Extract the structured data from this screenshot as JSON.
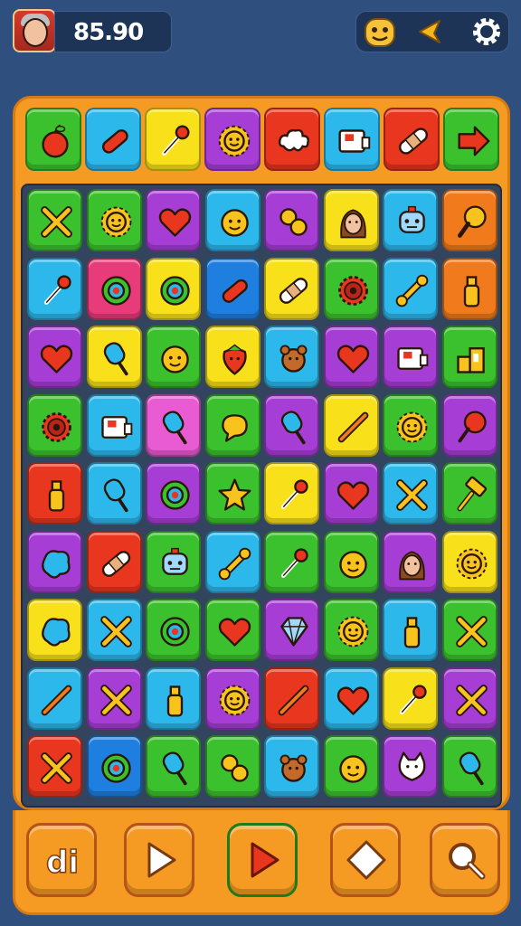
{
  "score": "85.90",
  "header": {
    "avatar_icon": "player-avatar",
    "emoji_icon": "smiley-face-icon",
    "arrow_icon": "back-triangle-icon",
    "settings_icon": "gear-icon"
  },
  "colors": {
    "board": "#f59a22",
    "background": "#2f4f7e",
    "grid_bg": "#33445e"
  },
  "top_row": [
    {
      "color": "#3cc12e",
      "icon": "apple"
    },
    {
      "color": "#2db8ec",
      "icon": "capsule"
    },
    {
      "color": "#f8e11a",
      "icon": "match"
    },
    {
      "color": "#a63ed6",
      "icon": "sun"
    },
    {
      "color": "#e8361f",
      "icon": "cloud"
    },
    {
      "color": "#2db8ec",
      "icon": "box"
    },
    {
      "color": "#e8361f",
      "icon": "bandage"
    },
    {
      "color": "#3cc12e",
      "icon": "arrow"
    }
  ],
  "grid_rows": [
    [
      {
        "color": "#3cc12e",
        "icon": "cross"
      },
      {
        "color": "#3cc12e",
        "icon": "sun"
      },
      {
        "color": "#a63ed6",
        "icon": "heart"
      },
      {
        "color": "#2db8ec",
        "icon": "face"
      },
      {
        "color": "#a63ed6",
        "icon": "dots"
      },
      {
        "color": "#f8e11a",
        "icon": "girl"
      },
      {
        "color": "#2db8ec",
        "icon": "robot"
      },
      {
        "color": "#f07a1c",
        "icon": "paddle"
      }
    ],
    [
      {
        "color": "#2db8ec",
        "icon": "match"
      },
      {
        "color": "#e83b7a",
        "icon": "donut"
      },
      {
        "color": "#f8e11a",
        "icon": "donut"
      },
      {
        "color": "#1f7fe0",
        "icon": "capsule"
      },
      {
        "color": "#f8e11a",
        "icon": "bandage"
      },
      {
        "color": "#3cc12e",
        "icon": "gear"
      },
      {
        "color": "#2db8ec",
        "icon": "bone"
      },
      {
        "color": "#f07a1c",
        "icon": "bottle"
      }
    ],
    [
      {
        "color": "#a63ed6",
        "icon": "heart"
      },
      {
        "color": "#f8e11a",
        "icon": "popsicle"
      },
      {
        "color": "#3cc12e",
        "icon": "face"
      },
      {
        "color": "#f8e11a",
        "icon": "strawberry"
      },
      {
        "color": "#2db8ec",
        "icon": "bear"
      },
      {
        "color": "#a63ed6",
        "icon": "heart"
      },
      {
        "color": "#a63ed6",
        "icon": "box"
      },
      {
        "color": "#3cc12e",
        "icon": "blocks"
      }
    ],
    [
      {
        "color": "#3cc12e",
        "icon": "gear"
      },
      {
        "color": "#2db8ec",
        "icon": "box"
      },
      {
        "color": "#e85bd2",
        "icon": "popsicle"
      },
      {
        "color": "#3cc12e",
        "icon": "bubble"
      },
      {
        "color": "#a63ed6",
        "icon": "popsicle"
      },
      {
        "color": "#f8e11a",
        "icon": "stick"
      },
      {
        "color": "#3cc12e",
        "icon": "sun"
      },
      {
        "color": "#a63ed6",
        "icon": "lollipop"
      }
    ],
    [
      {
        "color": "#e8361f",
        "icon": "bottle"
      },
      {
        "color": "#2db8ec",
        "icon": "popsicle"
      },
      {
        "color": "#a63ed6",
        "icon": "donut"
      },
      {
        "color": "#3cc12e",
        "icon": "star"
      },
      {
        "color": "#f8e11a",
        "icon": "match"
      },
      {
        "color": "#a63ed6",
        "icon": "heart"
      },
      {
        "color": "#2db8ec",
        "icon": "cross"
      },
      {
        "color": "#3cc12e",
        "icon": "hammer"
      }
    ],
    [
      {
        "color": "#a63ed6",
        "icon": "blob"
      },
      {
        "color": "#e8361f",
        "icon": "bandage"
      },
      {
        "color": "#3cc12e",
        "icon": "robot"
      },
      {
        "color": "#2db8ec",
        "icon": "bone"
      },
      {
        "color": "#3cc12e",
        "icon": "match"
      },
      {
        "color": "#3cc12e",
        "icon": "face"
      },
      {
        "color": "#a63ed6",
        "icon": "girl"
      },
      {
        "color": "#f8e11a",
        "icon": "sun"
      }
    ],
    [
      {
        "color": "#f8e11a",
        "icon": "blob"
      },
      {
        "color": "#2db8ec",
        "icon": "cross"
      },
      {
        "color": "#3cc12e",
        "icon": "donut"
      },
      {
        "color": "#3cc12e",
        "icon": "heart"
      },
      {
        "color": "#a63ed6",
        "icon": "gem"
      },
      {
        "color": "#3cc12e",
        "icon": "sun"
      },
      {
        "color": "#2db8ec",
        "icon": "bottle"
      },
      {
        "color": "#3cc12e",
        "icon": "cross"
      }
    ],
    [
      {
        "color": "#2db8ec",
        "icon": "stick"
      },
      {
        "color": "#a63ed6",
        "icon": "cross"
      },
      {
        "color": "#2db8ec",
        "icon": "bottle"
      },
      {
        "color": "#a63ed6",
        "icon": "sun"
      },
      {
        "color": "#e8361f",
        "icon": "stick"
      },
      {
        "color": "#2db8ec",
        "icon": "heart"
      },
      {
        "color": "#f8e11a",
        "icon": "match"
      },
      {
        "color": "#a63ed6",
        "icon": "cross"
      }
    ],
    [
      {
        "color": "#e8361f",
        "icon": "cross"
      },
      {
        "color": "#1f7fe0",
        "icon": "donut"
      },
      {
        "color": "#3cc12e",
        "icon": "popsicle"
      },
      {
        "color": "#3cc12e",
        "icon": "dots"
      },
      {
        "color": "#2db8ec",
        "icon": "bear"
      },
      {
        "color": "#3cc12e",
        "icon": "face"
      },
      {
        "color": "#a63ed6",
        "icon": "cat"
      },
      {
        "color": "#3cc12e",
        "icon": "popsicle"
      }
    ]
  ],
  "bottom_buttons": [
    {
      "color": "#f59a22",
      "icon": "letters-di"
    },
    {
      "color": "#f59a22",
      "icon": "play-outline"
    },
    {
      "color": "#3cc12e",
      "icon": "play-red"
    },
    {
      "color": "#f07a1c",
      "icon": "diamond"
    },
    {
      "color": "#f59a22",
      "icon": "magnifier"
    }
  ],
  "bottom_letters": "di"
}
